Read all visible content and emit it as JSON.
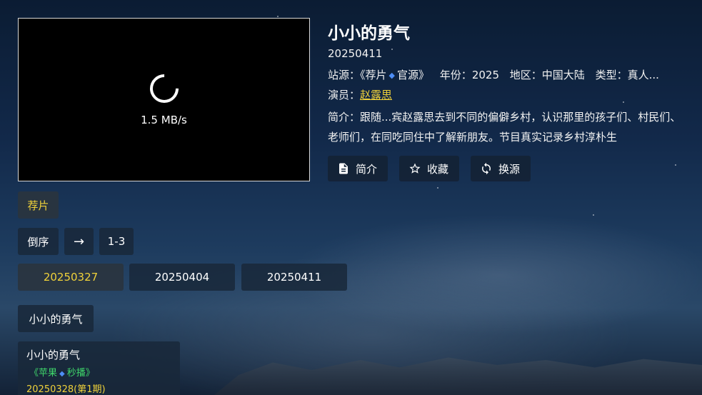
{
  "player": {
    "speed": "1.5 MB/s"
  },
  "details": {
    "title": "小小的勇气",
    "date": "20250411",
    "site_label": "站源：",
    "site_open": "《荐片",
    "site_sep_icon": "diamond-icon",
    "site_close": "官源》",
    "year_label": "年份：",
    "year": "2025",
    "region_label": "地区：",
    "region": "中国大陆",
    "type_label": "类型：",
    "type": "真人...",
    "actor_label": "演员：",
    "actor": "赵露思",
    "description": "简介：跟随...宾赵露思去到不同的偏僻乡村，认识那里的孩子们、村民们、老师们，在同吃同住中了解新朋友。节目真实记录乡村淳朴生"
  },
  "actions": {
    "intro_label": "简介",
    "favorite_label": "收藏",
    "switch_source_label": "换源"
  },
  "source_tab": "荐片",
  "episode_controls": {
    "sort_label": "倒序",
    "arrow": "→",
    "range": "1-3"
  },
  "episodes": [
    "20250327",
    "20250404",
    "20250411"
  ],
  "series_tab": "小小的勇气",
  "search_result": {
    "title": "小小的勇气",
    "source_open": "《苹果",
    "source_close": "秒播》",
    "episode": "20250328(第1期)"
  },
  "colors": {
    "accent_yellow": "#f0d23a",
    "source_green": "#3fd66a",
    "diamond_blue": "#4e8ef5"
  }
}
